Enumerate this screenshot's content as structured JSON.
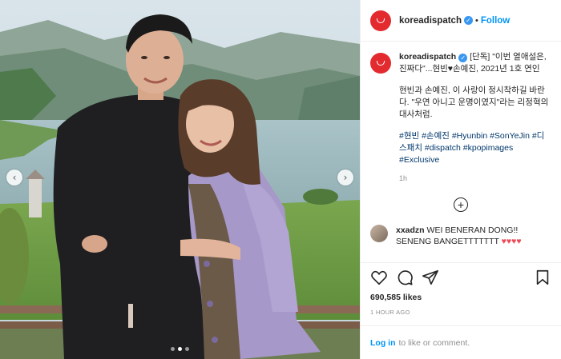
{
  "post": {
    "username": "koreadispatch",
    "follow_label": "Follow",
    "separator": "•",
    "caption_headline": "[단독] \"이번 열애설은, 진짜다\"...현빈♥손예진, 2021년 1호 연인",
    "caption_body": "현빈과 손예진, 이 사랑이 정시착하길 바란다. \"우연 아니고 운명이였지\"라는 리정혁의 대사처럼.",
    "hashtags": "#현빈 #손예진 #Hyunbin #SonYeJin #디스패치 #dispatch #kpopimages #Exclusive",
    "caption_time": "1h",
    "load_more_icon": "+",
    "comment": {
      "username": "xxadzn",
      "text": "WEI BENERAN DONG!! SENENG BANGETTTTTTT",
      "hearts": "♥♥♥♥"
    },
    "likes": "690,585 likes",
    "posted_ago": "1 HOUR AGO",
    "login_link": "Log in",
    "login_suffix": "to like or comment."
  },
  "carousel": {
    "prev_glyph": "‹",
    "next_glyph": "›",
    "slide_count": 3,
    "active_slide": 2
  },
  "icons": {
    "verified": "verified-badge-icon",
    "like": "heart-icon",
    "comment": "comment-icon",
    "share": "paper-plane-icon",
    "save": "bookmark-icon",
    "load_more": "plus-circle-icon"
  },
  "colors": {
    "brand_avatar": "#e32a2f",
    "link": "#0095f6",
    "hashtag": "#00376b",
    "verified": "#3897f0"
  }
}
